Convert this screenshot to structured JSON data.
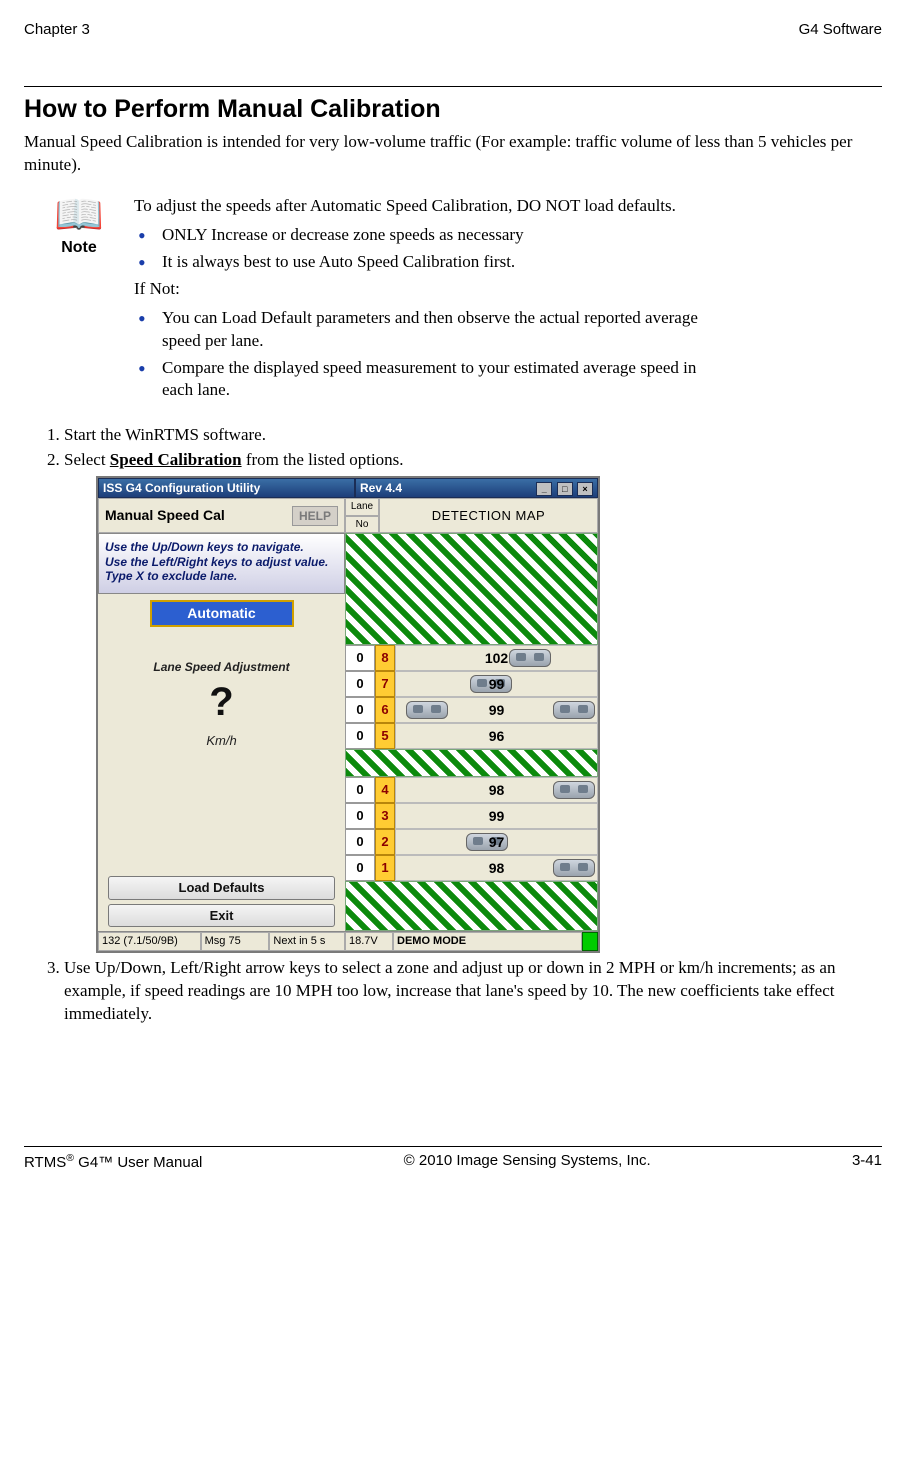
{
  "page": {
    "header_left": "Chapter 3",
    "header_right": "G4 Software",
    "footer_left_pre": "RTMS",
    "footer_left_sup": "®",
    "footer_left_mid": " G4™ User Manual",
    "footer_center": "© 2010 Image Sensing Systems, Inc.",
    "footer_right": "3-41"
  },
  "section": {
    "title": "How to Perform Manual Calibration",
    "intro": "Manual Speed Calibration is intended for very low-volume traffic (For example: traffic volume of less than 5 vehicles per minute)."
  },
  "note": {
    "icon": "📖",
    "label": "Note",
    "lead": "To adjust the speeds after Automatic Speed Calibration, DO NOT load defaults.",
    "bullets_a": [
      "ONLY Increase or decrease zone speeds as necessary",
      "It is always best to use Auto Speed Calibration first."
    ],
    "mid": "If Not:",
    "bullets_b": [
      "You can Load Default parameters and then observe the actual reported average speed per lane.",
      "Compare the displayed speed measurement to your estimated average speed in each lane."
    ]
  },
  "steps": {
    "s1": "Start the WinRTMS software.",
    "s2_pre": "Select ",
    "s2_bold": "Speed Calibration",
    "s2_post": " from the listed options.",
    "s3": "Use Up/Down, Left/Right arrow keys to select a zone and adjust up or down in 2 MPH or km/h increments; as an example, if speed readings are 10 MPH too low, increase that lane's speed by 10. The new coefficients take effect immediately."
  },
  "app": {
    "title_left": "ISS G4 Configuration Utility",
    "title_right": "Rev 4.4",
    "panel_title": "Manual Speed Cal",
    "help": "HELP",
    "col_lane": "Lane",
    "col_no": "No",
    "map_title": "DETECTION MAP",
    "instructions_l1": "Use the Up/Down keys to navigate.",
    "instructions_l2": "Use the Left/Right keys to adjust value.",
    "instructions_l3": "Type X to exclude lane.",
    "automatic": "Automatic",
    "lsa_title": "Lane Speed Adjustment",
    "lsa_mark": "?",
    "unit": "Km/h",
    "btn_defaults": "Load Defaults",
    "btn_exit": "Exit",
    "lanes_top": [
      {
        "adj": "0",
        "id": "8",
        "speed": "102",
        "car_pos": "right:46px"
      },
      {
        "adj": "0",
        "id": "7",
        "speed": "99",
        "car_pos": "left:74px"
      },
      {
        "adj": "0",
        "id": "6",
        "speed": "99",
        "car_pos": "right:2px;  "
      },
      {
        "adj": "0",
        "id": "5",
        "speed": "96",
        "car_pos": ""
      }
    ],
    "lanes_bot": [
      {
        "adj": "0",
        "id": "4",
        "speed": "98",
        "car_pos": "right:2px"
      },
      {
        "adj": "0",
        "id": "3",
        "speed": "99",
        "car_pos": ""
      },
      {
        "adj": "0",
        "id": "2",
        "speed": "97",
        "car_pos": "left:70px"
      },
      {
        "adj": "0",
        "id": "1",
        "speed": "98",
        "car_pos": "right:2px"
      }
    ],
    "lanes_top_extra_car": "left:10px",
    "status": {
      "l1": "132 (7.1/50/9B)",
      "l2": "Msg 75",
      "l3": "Next in 5 s",
      "r1": "18.7V",
      "r2": "DEMO MODE"
    }
  }
}
